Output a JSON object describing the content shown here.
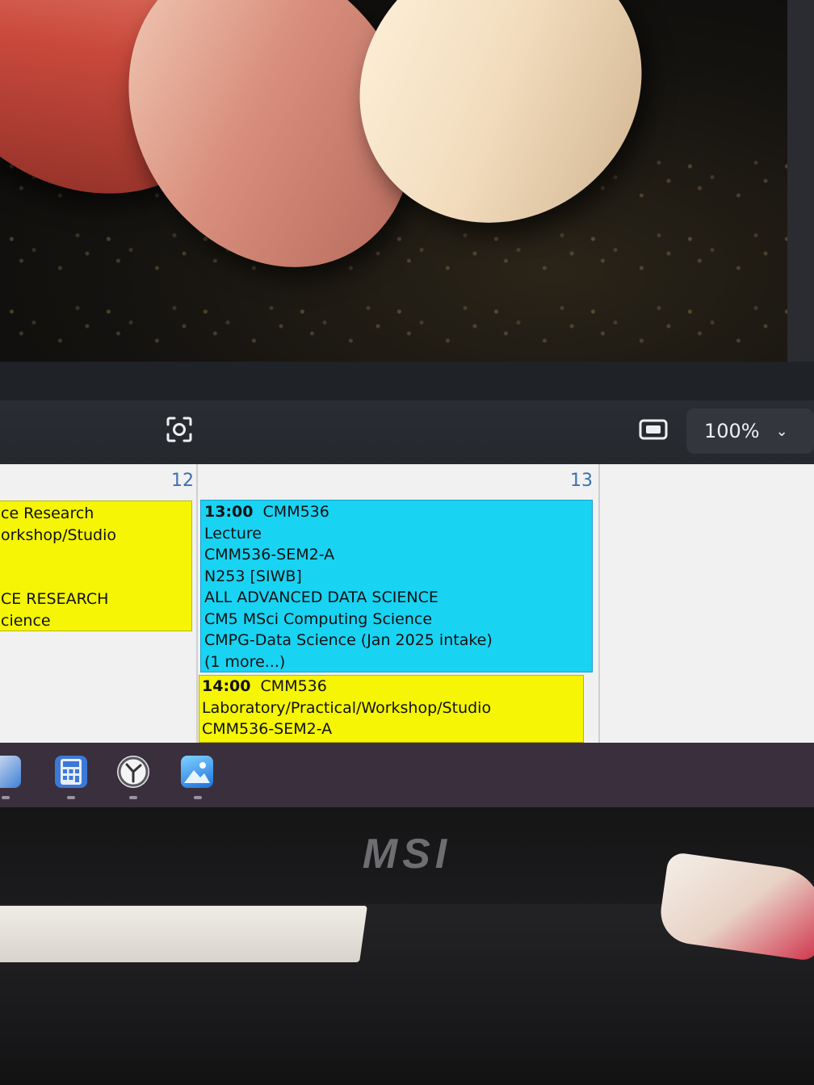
{
  "viewer": {
    "zoom_value": "100%"
  },
  "calendar": {
    "days": [
      {
        "number": "12",
        "events": [
          {
            "lines": [
              "ce Research",
              "orkshop/Studio",
              "",
              "",
              "CE RESEARCH",
              "cience"
            ],
            "color": "#f5f505"
          }
        ]
      },
      {
        "number": "13",
        "events": [
          {
            "time": "13:00",
            "code": "CMM536",
            "lines": [
              "Lecture",
              "CMM536-SEM2-A",
              "N253 [SIWB]",
              "ALL ADVANCED DATA SCIENCE",
              "CM5 MSci Computing Science",
              "CMPG-Data Science (Jan 2025 intake)",
              "(1 more...)"
            ],
            "color": "#19d3f3"
          },
          {
            "time": "14:00",
            "code": "CMM536",
            "lines": [
              "Laboratory/Practical/Workshop/Studio",
              "CMM536-SEM2-A"
            ],
            "color": "#f5f505"
          }
        ]
      }
    ]
  },
  "taskbar": {
    "apps": [
      {
        "icon": "pen-app-icon"
      },
      {
        "icon": "calculator-icon"
      },
      {
        "icon": "clock-icon"
      },
      {
        "icon": "photos-icon"
      }
    ]
  },
  "laptop": {
    "brand": "MSI"
  }
}
